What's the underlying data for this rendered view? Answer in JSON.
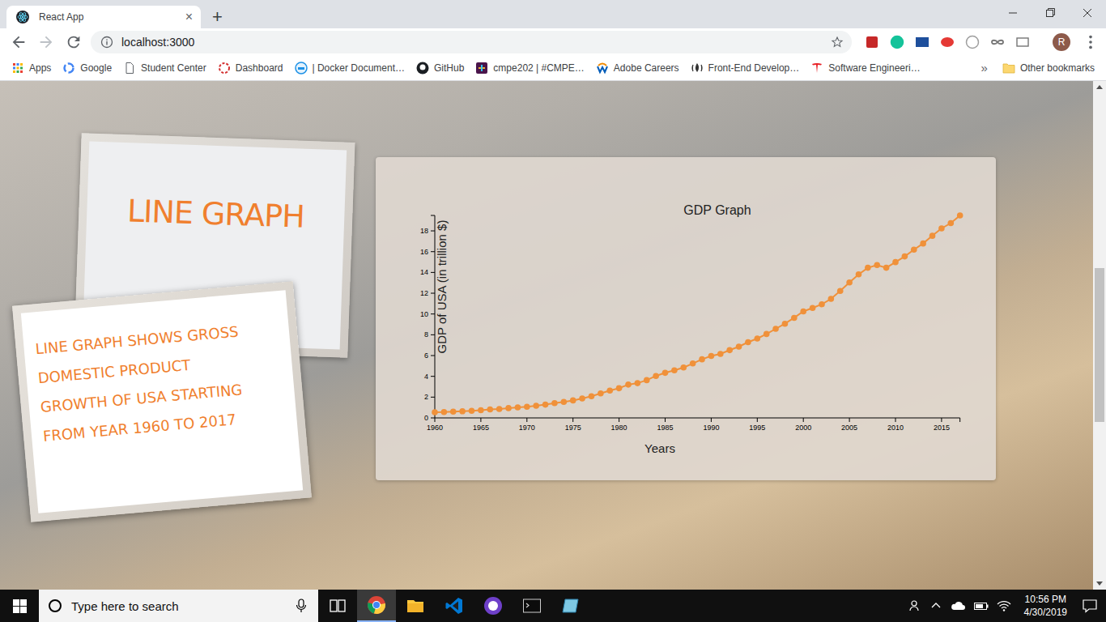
{
  "window": {
    "tab": {
      "label": "React App",
      "close": "×",
      "selected": true
    },
    "new_tab": "+"
  },
  "toolbar": {
    "address": "localhost:3000",
    "avatar": "R"
  },
  "bookmarks": [
    {
      "label": "Apps",
      "kind": "grid"
    },
    {
      "label": "Google",
      "kind": "google"
    },
    {
      "label": "Student Center",
      "kind": "page"
    },
    {
      "label": "Dashboard",
      "kind": "ring"
    },
    {
      "label": "| Docker Document…",
      "kind": "docker"
    },
    {
      "label": "GitHub",
      "kind": "github"
    },
    {
      "label": "cmpe202 | #CMPE…",
      "kind": "slack"
    },
    {
      "label": "Adobe Careers",
      "kind": "workday"
    },
    {
      "label": "Front-End Develop…",
      "kind": "fcc"
    },
    {
      "label": "Software Engineeri…",
      "kind": "tesla"
    }
  ],
  "bookmarks_more": "»",
  "other_bookmarks": "Other bookmarks",
  "page": {
    "title_card": "LINE GRAPH",
    "description": [
      "LINE GRAPH SHOWS GROSS",
      "DOMESTIC PRODUCT",
      "GROWTH OF USA STARTING",
      "FROM YEAR 1960 TO 2017"
    ],
    "chart": {
      "title": "GDP Graph",
      "y_label": "GDP of USA (in trillion $)",
      "x_label": "Years",
      "y_ticks": [
        "0",
        "2",
        "4",
        "6",
        "8",
        "10",
        "12",
        "14",
        "16",
        "18"
      ],
      "x_ticks": [
        "1960",
        "1965",
        "1970",
        "1975",
        "1980",
        "1985",
        "1990",
        "1995",
        "2000",
        "2005",
        "2010",
        "2015"
      ],
      "values": [
        0.543,
        0.563,
        0.605,
        0.638,
        0.686,
        0.744,
        0.815,
        0.862,
        0.943,
        1.019,
        1.073,
        1.165,
        1.28,
        1.425,
        1.545,
        1.684,
        1.873,
        2.082,
        2.352,
        2.627,
        2.857,
        3.207,
        3.343,
        3.634,
        4.037,
        4.339,
        4.579,
        4.855,
        5.236,
        5.641,
        5.963,
        6.158,
        6.52,
        6.858,
        7.287,
        7.64,
        8.073,
        8.577,
        9.062,
        9.631,
        10.252,
        10.582,
        10.936,
        11.458,
        12.214,
        13.037,
        13.815,
        14.452,
        14.713,
        14.449,
        14.992,
        15.543,
        16.197,
        16.785,
        17.527,
        18.238,
        18.745,
        19.485
      ]
    }
  },
  "scrollbar": {
    "thumb_start": 0.36,
    "thumb_size": 0.32
  },
  "taskbar": {
    "search_placeholder": "Type here to search",
    "apps": [
      {
        "kind": "taskview",
        "selected": false
      },
      {
        "kind": "chrome",
        "selected": true
      },
      {
        "kind": "explorer",
        "selected": false
      },
      {
        "kind": "vscode",
        "selected": false
      },
      {
        "kind": "github",
        "selected": false
      },
      {
        "kind": "terminal",
        "selected": false
      },
      {
        "kind": "notes",
        "selected": false
      }
    ],
    "time": "10:56 PM",
    "date": "4/30/2019"
  }
}
